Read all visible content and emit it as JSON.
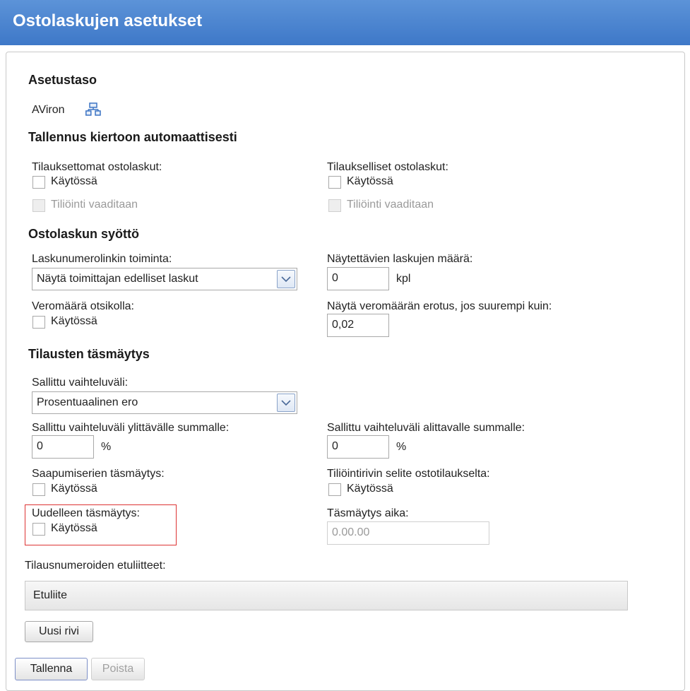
{
  "title": "Ostolaskujen asetukset",
  "asetustaso": {
    "heading": "Asetustaso",
    "value": "AViron",
    "icon": "hierarchy-icon"
  },
  "tallennus": {
    "heading": "Tallennus kiertoon automaattisesti",
    "left_label": "Tilauksettomat ostolaskut:",
    "left_enabled": "Käytössä",
    "left_tiliointi": "Tiliöinti vaaditaan",
    "right_label": "Tilaukselliset ostolaskut:",
    "right_enabled": "Käytössä",
    "right_tiliointi": "Tiliöinti vaaditaan"
  },
  "syotto": {
    "heading": "Ostolaskun syöttö",
    "link_label": "Laskunumerolinkin toiminta:",
    "link_value": "Näytä toimittajan edelliset laskut",
    "count_label": "Näytettävien laskujen määrä:",
    "count_value": "0",
    "count_unit": "kpl",
    "tax_label": "Veromäärä otsikolla:",
    "tax_enabled": "Käytössä",
    "diff_label": "Näytä veromäärän erotus, jos suurempi kuin:",
    "diff_value": "0,02"
  },
  "tasmaytys": {
    "heading": "Tilausten täsmäytys",
    "range_label": "Sallittu vaihteluväli:",
    "range_value": "Prosentuaalinen ero",
    "over_label": "Sallittu vaihteluväli ylittävälle summalle:",
    "over_value": "0",
    "over_unit": "%",
    "under_label": "Sallittu vaihteluväli alittavalle summalle:",
    "under_value": "0",
    "under_unit": "%",
    "arrival_label": "Saapumiserien täsmäytys:",
    "arrival_enabled": "Käytössä",
    "desc_label": "Tiliöintirivin selite ostotilaukselta:",
    "desc_enabled": "Käytössä",
    "rematch_label": "Uudelleen täsmäytys:",
    "rematch_enabled": "Käytössä",
    "time_label": "Täsmäytys aika:",
    "time_placeholder": "0.00.00"
  },
  "prefixes": {
    "label": "Tilausnumeroiden etuliitteet:",
    "column": "Etuliite",
    "new_row": "Uusi rivi"
  },
  "actions": {
    "save": "Tallenna",
    "delete": "Poista"
  }
}
